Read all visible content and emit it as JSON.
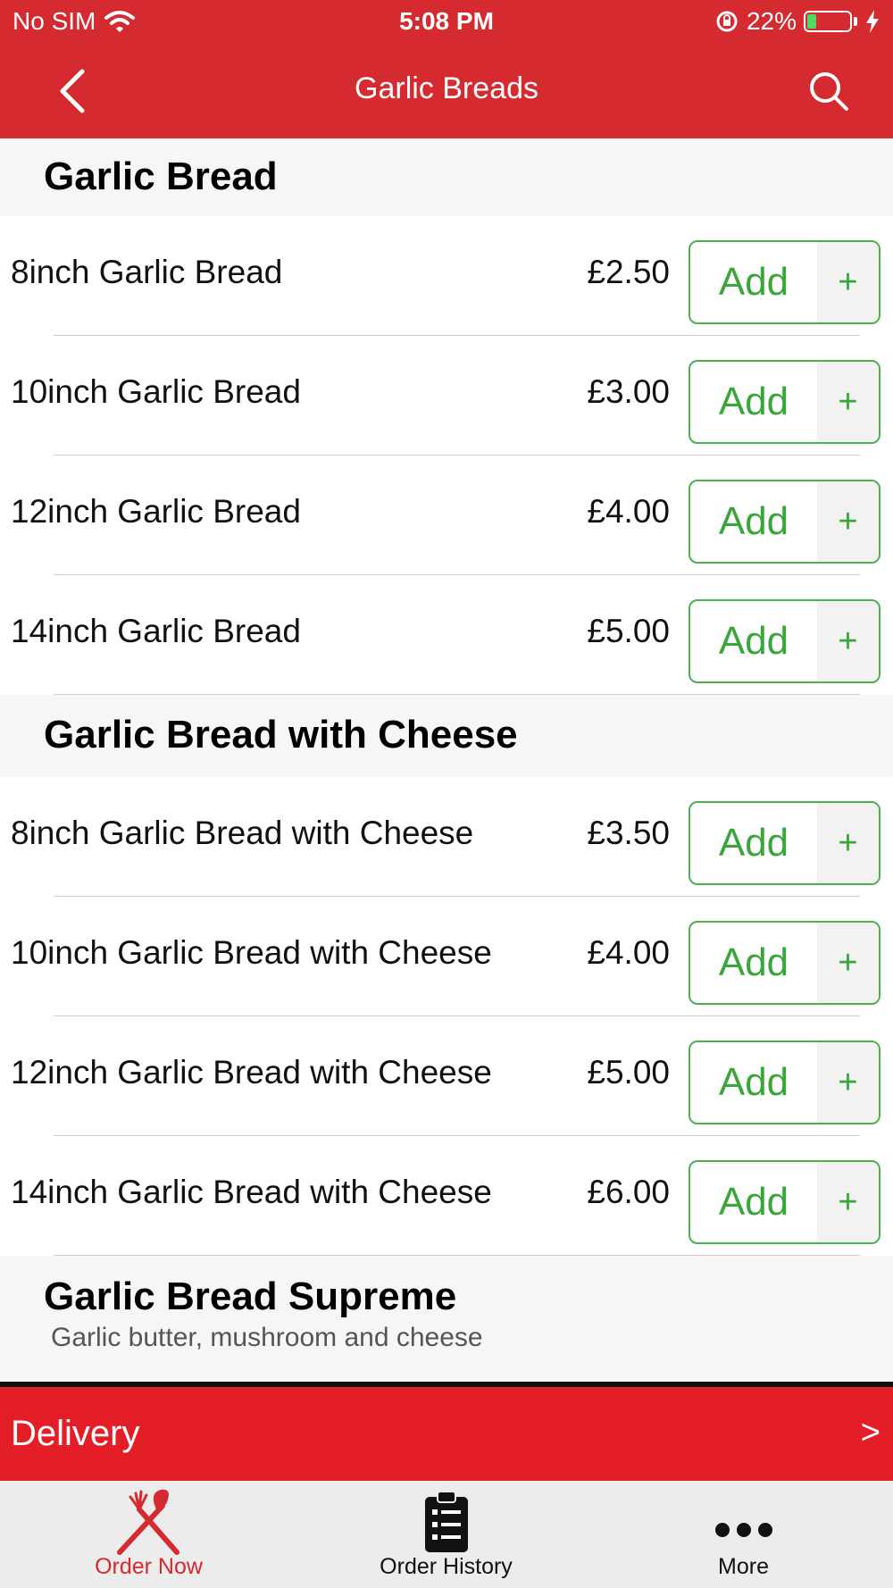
{
  "status_bar": {
    "carrier": "No SIM",
    "time": "5:08 PM",
    "battery_percent": "22%",
    "battery_level": 0.22,
    "battery_color": "#4cd964"
  },
  "header": {
    "title": "Garlic Breads",
    "back_icon": "chevron-left-icon",
    "search_icon": "search-icon",
    "background_color": "#d42a30"
  },
  "sections": [
    {
      "title": "Garlic Bread",
      "items": [
        {
          "name": "8inch Garlic Bread",
          "price": "£2.50"
        },
        {
          "name": "10inch Garlic Bread",
          "price": "£3.00"
        },
        {
          "name": "12inch Garlic Bread",
          "price": "£4.00"
        },
        {
          "name": "14inch Garlic Bread",
          "price": "£5.00"
        }
      ]
    },
    {
      "title": "Garlic Bread with Cheese",
      "items": [
        {
          "name": "8inch Garlic Bread with Cheese",
          "price": "£3.50"
        },
        {
          "name": "10inch Garlic Bread with Cheese",
          "price": "£4.00"
        },
        {
          "name": "12inch Garlic Bread with Cheese",
          "price": "£5.00"
        },
        {
          "name": "14inch Garlic Bread with Cheese",
          "price": "£6.00"
        }
      ]
    },
    {
      "title": "Garlic Bread Supreme",
      "description": "Garlic butter, mushroom and cheese",
      "items": []
    }
  ],
  "add_button": {
    "label": "Add",
    "plus": "+",
    "color": "#3aa53a"
  },
  "delivery_bar": {
    "label": "Delivery",
    "arrow": ">",
    "color": "#e41e26"
  },
  "tab_bar": {
    "tabs": [
      {
        "label": "Order Now",
        "icon": "fork-knife-icon",
        "active": true,
        "color": "#d42a30"
      },
      {
        "label": "Order History",
        "icon": "clipboard-list-icon",
        "active": false,
        "color": "#111111"
      },
      {
        "label": "More",
        "icon": "more-dots-icon",
        "active": false,
        "color": "#111111"
      }
    ]
  }
}
